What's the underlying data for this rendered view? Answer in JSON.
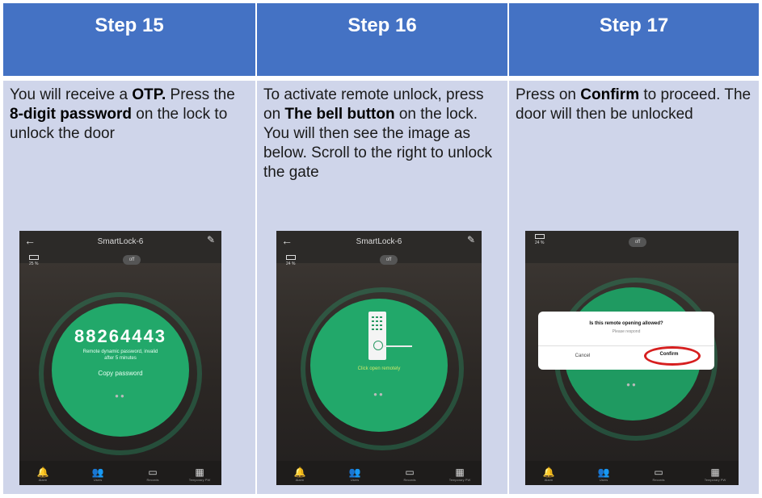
{
  "steps": [
    {
      "header": "Step 15",
      "text": {
        "t1": "You will receive a ",
        "b1": "OTP.",
        "t2": " Press the ",
        "b2": "8-digit password",
        "t3": " on the lock to unlock the door"
      },
      "phone": {
        "title": "SmartLock-6",
        "battery": "25 %",
        "toggle": "off",
        "otp": "88264443",
        "note1": "Remote dynamic password, invalid",
        "note2": "after 5 minutes",
        "copy": "Copy password"
      }
    },
    {
      "header": "Step 16",
      "text": {
        "t1": "To activate remote unlock, press on ",
        "b1": "The bell button",
        "t2": " on the lock. You will then see the image as below. Scroll to the right to unlock the gate"
      },
      "phone": {
        "title": "SmartLock-6",
        "battery": "24 %",
        "toggle": "off",
        "hint": "Click open remotely"
      }
    },
    {
      "header": "Step 17",
      "text": {
        "t1": "Press on ",
        "b1": "Confirm",
        "t2": " to proceed. The door will then be unlocked"
      },
      "phone": {
        "battery": "24 %",
        "toggle": "off",
        "question": "Is this remote opening allowed?",
        "prompt": "Please respond",
        "cancel": "Cancel",
        "confirm": "Confirm"
      }
    }
  ],
  "tabs": [
    "Alarm",
    "Users",
    "Records",
    "Temporary PW"
  ],
  "colors": {
    "header": "#4472c4",
    "panel": "#cfd5ea",
    "green": "#22a86a",
    "highlight": "#d61f1f"
  }
}
